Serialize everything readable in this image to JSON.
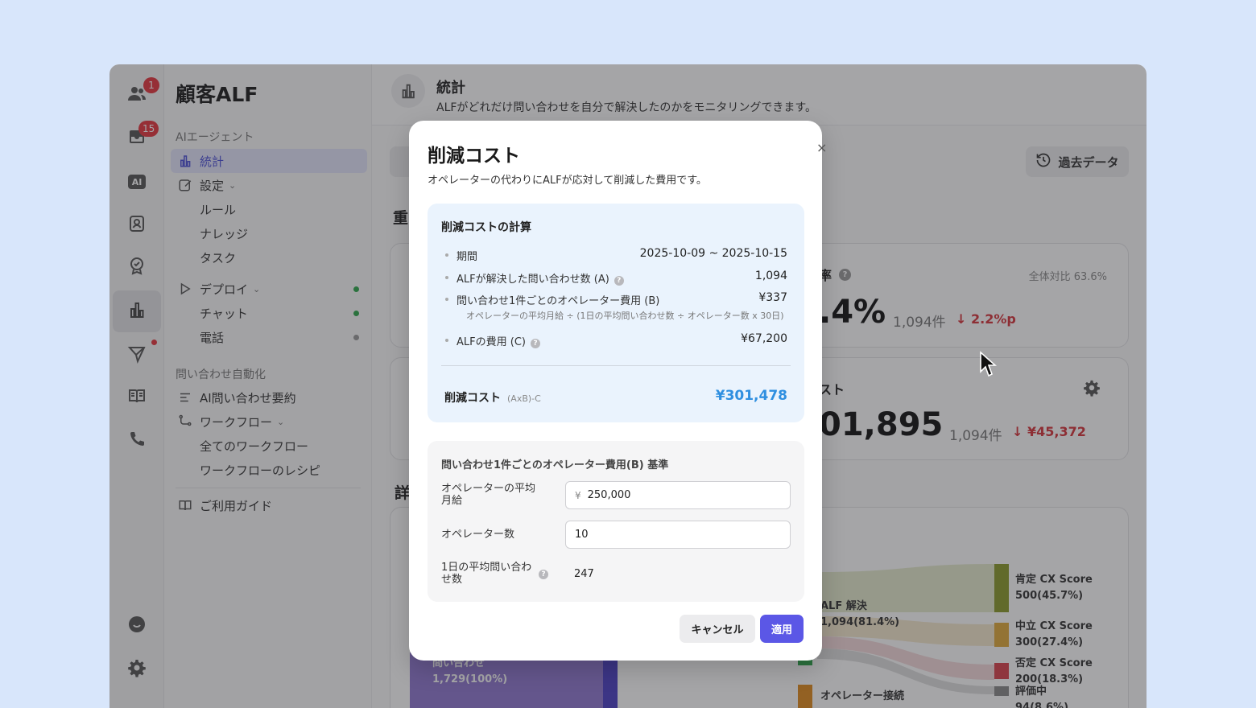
{
  "rail": {
    "contacts_badge": "1",
    "inbox_badge": "15",
    "ai_label": "AI"
  },
  "sidebar": {
    "brand": "顧客ALF",
    "section_ai": "AIエージェント",
    "items": {
      "stats": "統計",
      "settings": "設定",
      "rules": "ルール",
      "knowledge": "ナレッジ",
      "tasks": "タスク",
      "deploy": "デプロイ",
      "chat": "チャット",
      "phone": "電話"
    },
    "section_auto": "問い合わせ自動化",
    "auto_items": {
      "summary": "AI問い合わせ要約",
      "workflow": "ワークフロー",
      "all_workflows": "全てのワークフロー",
      "recipes": "ワークフローのレシピ"
    },
    "guide": "ご利用ガイド"
  },
  "header": {
    "title": "統計",
    "description": "ALFがどれだけ問い合わせを自分で解決したのかをモニタリングできます。",
    "past_data": "過去データ"
  },
  "main": {
    "section_key": "重",
    "section_detail": "詳",
    "card1": {
      "label": "率",
      "ratio": "全体対比 63.6%",
      "big": ".4%",
      "count": "1,094件",
      "change": "2.2%p"
    },
    "card2": {
      "label": "スト",
      "big": "01,895",
      "count": "1,094件",
      "change": "¥45,372"
    },
    "sankey": {
      "source_name": "問い合わせ",
      "source_value": "1,729(100%)",
      "resolved_name": "ALF 解決",
      "resolved_value": "1,094(81.4%)",
      "operator_name": "オペレーター接続",
      "positive_name": "肯定 CX Score",
      "positive_value": "500(45.7%)",
      "neutral_name": "中立 CX Score",
      "neutral_value": "300(27.4%)",
      "negative_name": "否定 CX Score",
      "negative_value": "200(18.3%)",
      "pending_name": "評価中",
      "pending_value": "94(8.6%)",
      "colors": {
        "positive": "#8a9a2a",
        "neutral": "#e0a93a",
        "negative": "#d9404a",
        "pending": "#888888",
        "source": "#7b5fc9",
        "operator": "#e08a1c"
      }
    }
  },
  "modal": {
    "title": "削減コスト",
    "close": "×",
    "description": "オペレーターの代わりにALFが応対して削減した費用です。",
    "calc_title": "削減コストの計算",
    "period_label": "期間",
    "period_value": "2025-10-09 ~ 2025-10-15",
    "resolved_label": "ALFが解決した問い合わせ数 (A)",
    "resolved_value": "1,094",
    "per_cost_label": "問い合わせ1件ごとのオペレーター費用 (B)",
    "per_cost_value": "¥337",
    "per_cost_formula": "オペレーターの平均月給 ÷ (1日の平均問い合わせ数 ÷ オペレーター数 x 30日)",
    "alf_cost_label": "ALFの費用 (C)",
    "alf_cost_value": "¥67,200",
    "total_label": "削減コスト",
    "total_formula": "(AxB)-C",
    "total_value": "¥301,478",
    "basis_title": "問い合わせ1件ごとのオペレーター費用(B) 基準",
    "salary_label_line1": "オペレーターの平均",
    "salary_label_line2": "月給",
    "salary_currency": "¥",
    "salary_value": "250,000",
    "operators_label": "オペレーター数",
    "operators_value": "10",
    "daily_label_line1": "1日の平均問い合わ",
    "daily_label_line2": "せ数",
    "daily_value": "247",
    "cancel": "キャンセル",
    "apply": "適用",
    "accent": "#5b57e6",
    "total_color": "#2f8fe0"
  }
}
